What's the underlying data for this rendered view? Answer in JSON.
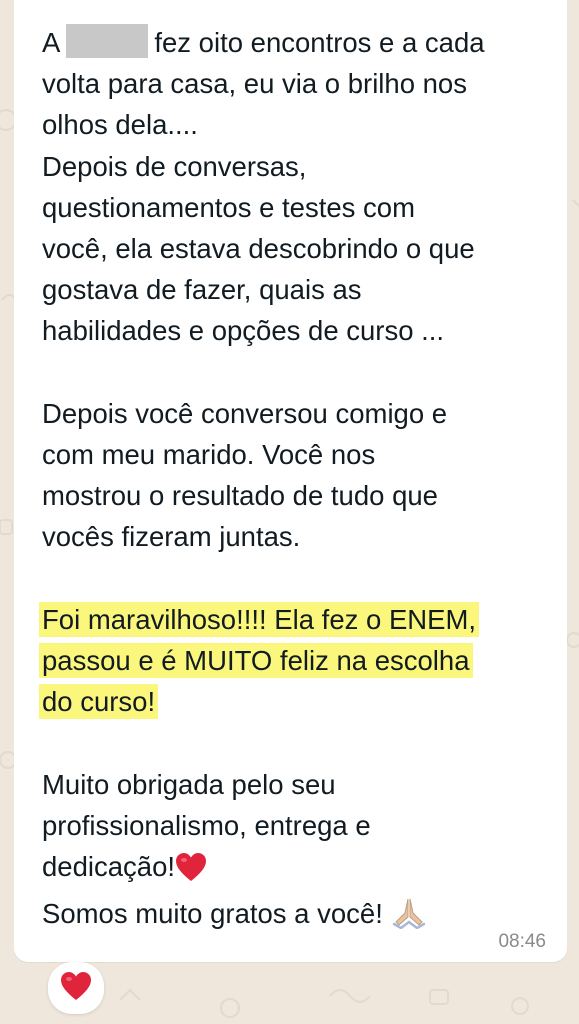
{
  "chat": {
    "message": {
      "line1_start": "A",
      "line1_end": "fez oito encontros e a cada",
      "line2": "volta para casa, eu via o brilho nos",
      "line3": "olhos dela....",
      "line4": "Depois de conversas,",
      "line5": "questionamentos e testes com",
      "line6": "você, ela estava descobrindo o que",
      "line7": "gostava de fazer, quais as",
      "line8": "habilidades e opções de curso ...",
      "line9": "Depois você conversou comigo e",
      "line10": "com meu marido. Você nos",
      "line11": "mostrou o resultado de tudo que",
      "line12": "vocês fizeram juntas.",
      "hl1": "Foi maravilhoso!!!! Ela fez o ENEM,",
      "hl2": "passou e é MUITO feliz na escolha",
      "hl3": "do curso!",
      "line16": "Muito obrigada pelo seu",
      "line17": "profissionalismo, entrega e",
      "line18": "dedicação!",
      "line19": "Somos muito gratos a você!"
    },
    "timestamp": "08:46",
    "reaction": "heart-emoji"
  },
  "colors": {
    "background": "#efe7dc",
    "bubble": "#ffffff",
    "highlight": "#fbf77d",
    "text": "#111b21",
    "timestamp": "#8a8a8a",
    "heart": "#e0243c"
  },
  "icons": [
    "heart-emoji",
    "praying-hands-emoji"
  ]
}
